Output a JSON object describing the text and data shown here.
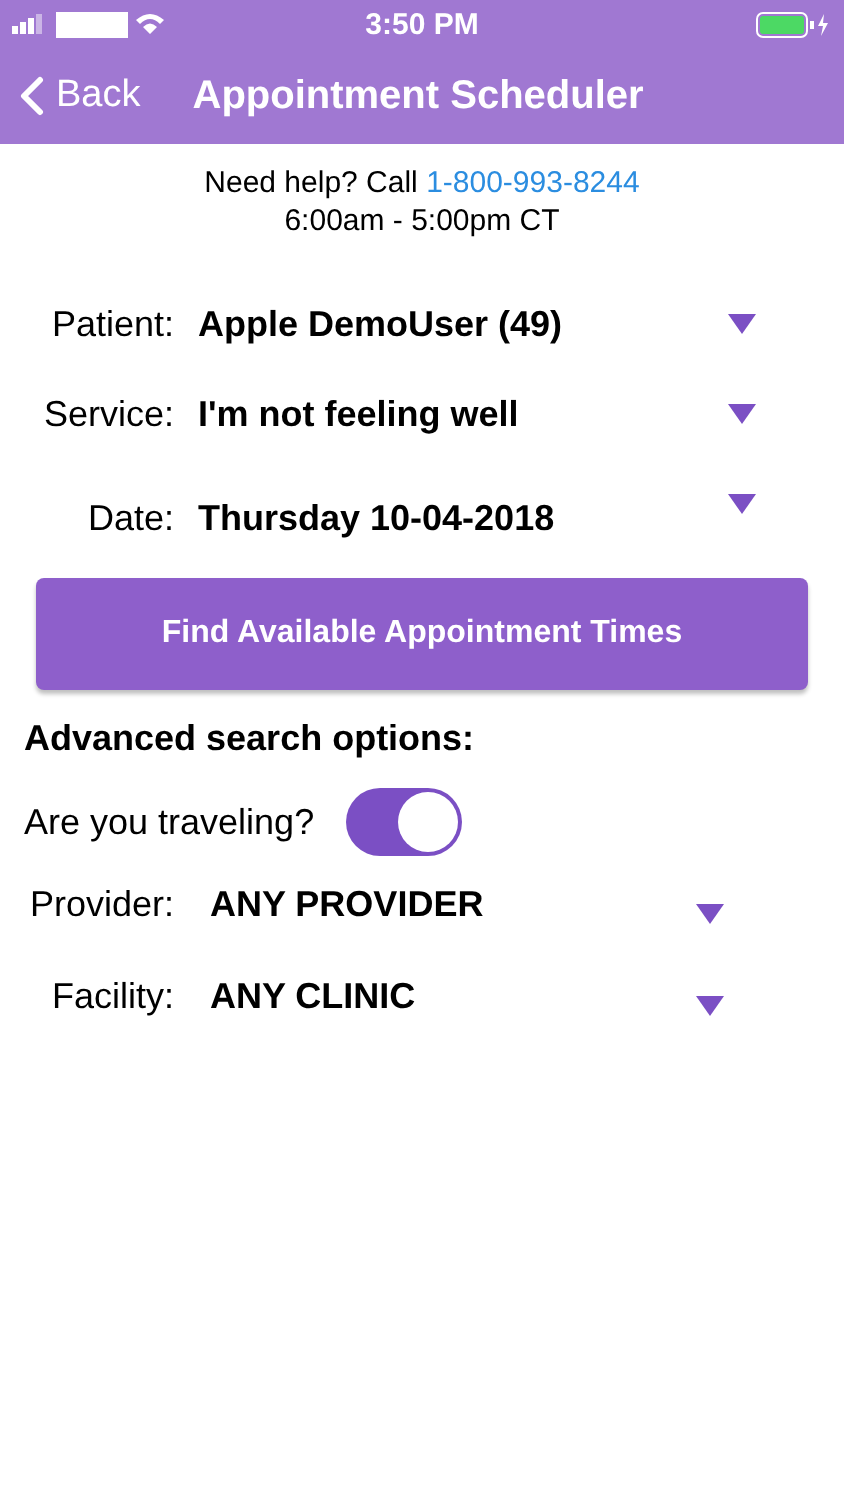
{
  "status_bar": {
    "time": "3:50 PM"
  },
  "nav_bar": {
    "back": "Back",
    "title": "Appointment Scheduler"
  },
  "help": {
    "prefix": "Need help? Call ",
    "phone": "1-800-993-8244",
    "hours": "6:00am - 5:00pm CT"
  },
  "fields": [
    {
      "label": "Patient:",
      "value": "Apple DemoUser (49)"
    },
    {
      "label": "Service:",
      "value": "I'm not feeling well"
    },
    {
      "label": "Date:",
      "value": "Thursday 10-04-2018"
    }
  ],
  "find_button": "Find Available Appointment Times",
  "advanced": {
    "heading": "Advanced search options:",
    "traveling": {
      "label": "Are you traveling?",
      "on": true
    },
    "fields": [
      {
        "label": "Provider:",
        "value": "ANY PROVIDER"
      },
      {
        "label": "Facility:",
        "value": "ANY CLINIC"
      }
    ]
  }
}
